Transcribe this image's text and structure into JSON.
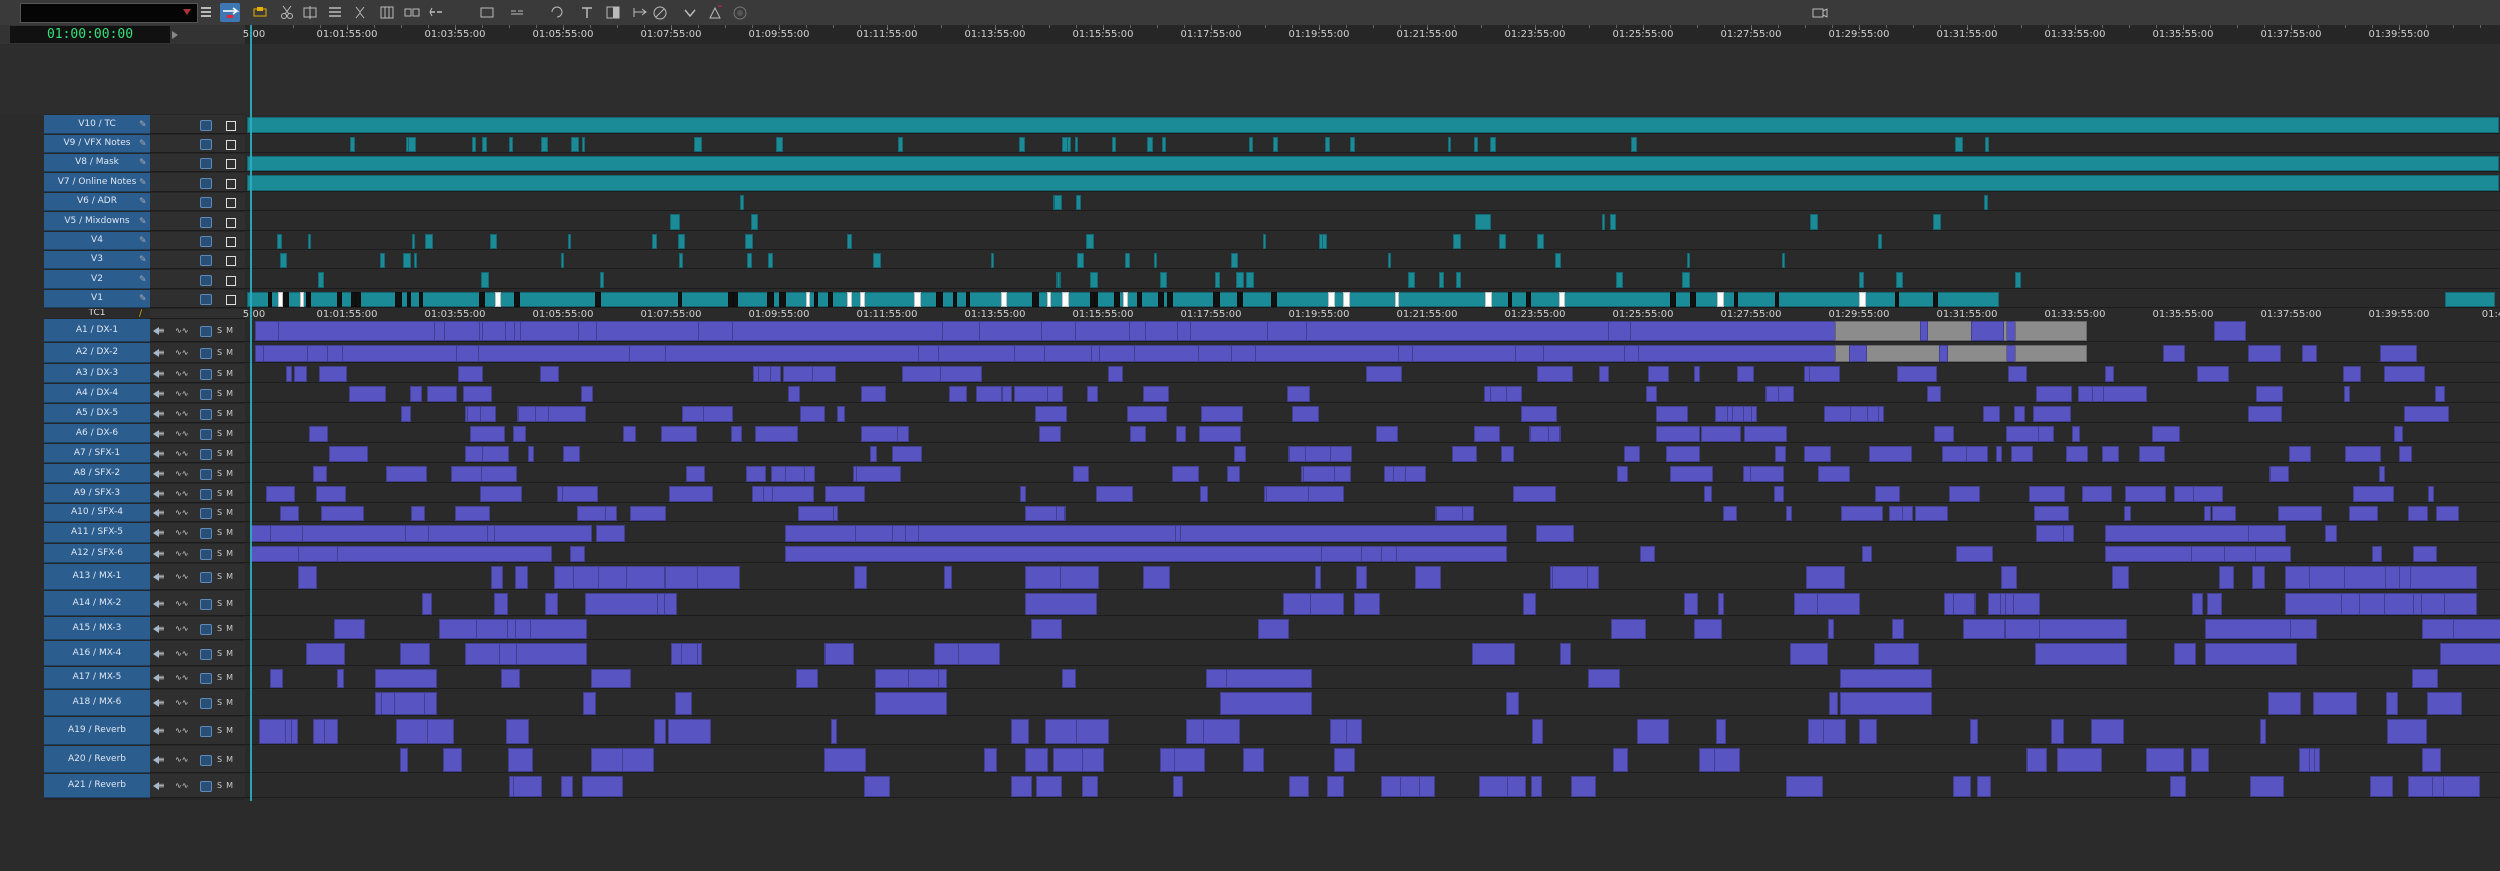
{
  "toolbar": {
    "timecode_label": "",
    "tools": [
      {
        "name": "segment-mode-icon",
        "active": false
      },
      {
        "name": "lift-overwrite-icon",
        "active": true
      },
      {
        "name": "extract-splice-icon",
        "active": false
      },
      {
        "name": "cut-icon",
        "active": false
      },
      {
        "name": "trim-icon",
        "active": false
      },
      {
        "name": "list-icon",
        "active": false
      },
      {
        "name": "split-icon",
        "active": false
      },
      {
        "name": "grid-icon",
        "active": false
      },
      {
        "name": "ripple-icon",
        "active": false
      },
      {
        "name": "snap-icon",
        "active": false
      },
      {
        "name": "add-edit-icon",
        "active": false
      },
      {
        "name": "link-icon",
        "active": false
      },
      {
        "name": "refresh-icon",
        "active": false
      },
      {
        "name": "text-icon",
        "active": false
      },
      {
        "name": "split-view-icon",
        "active": false
      },
      {
        "name": "trim-in-icon",
        "active": false
      },
      {
        "name": "no-icon",
        "active": false
      },
      {
        "name": "checkmark-icon",
        "active": false
      },
      {
        "name": "arrow-tool-icon",
        "active": false
      },
      {
        "name": "record-icon",
        "active": false
      },
      {
        "name": "render-icon",
        "active": false
      }
    ]
  },
  "master_timecode": "01:00:00:00",
  "ruler": {
    "first_label": "5:00",
    "labels": [
      "01:01:55:00",
      "01:03:55:00",
      "01:05:55:00",
      "01:07:55:00",
      "01:09:55:00",
      "01:11:55:00",
      "01:13:55:00",
      "01:15:55:00",
      "01:17:55:00",
      "01:19:55:00",
      "01:21:55:00",
      "01:23:55:00",
      "01:25:55:00",
      "01:27:55:00",
      "01:29:55:00",
      "01:31:55:00",
      "01:33:55:00",
      "01:35:55:00",
      "01:37:55:00",
      "01:39:55:00"
    ],
    "last_label": "01:4"
  },
  "tracks": [
    {
      "name": "V10 / TC",
      "kind": "video"
    },
    {
      "name": "V9 / VFX Notes",
      "kind": "video"
    },
    {
      "name": "V8 / Mask",
      "kind": "video"
    },
    {
      "name": "V7 / Online Notes",
      "kind": "video"
    },
    {
      "name": "V6 / ADR",
      "kind": "video"
    },
    {
      "name": "V5 / Mixdowns",
      "kind": "video"
    },
    {
      "name": "V4",
      "kind": "video"
    },
    {
      "name": "V3",
      "kind": "video"
    },
    {
      "name": "V2",
      "kind": "video"
    },
    {
      "name": "V1",
      "kind": "video"
    },
    {
      "name": "TC1",
      "kind": "timecode"
    },
    {
      "name": "A1 / DX-1",
      "kind": "audio"
    },
    {
      "name": "A2 / DX-2",
      "kind": "audio"
    },
    {
      "name": "A3 / DX-3",
      "kind": "audio"
    },
    {
      "name": "A4 / DX-4",
      "kind": "audio"
    },
    {
      "name": "A5 / DX-5",
      "kind": "audio"
    },
    {
      "name": "A6 / DX-6",
      "kind": "audio"
    },
    {
      "name": "A7 / SFX-1",
      "kind": "audio"
    },
    {
      "name": "A8 / SFX-2",
      "kind": "audio"
    },
    {
      "name": "A9 / SFX-3",
      "kind": "audio"
    },
    {
      "name": "A10 / SFX-4",
      "kind": "audio"
    },
    {
      "name": "A11 / SFX-5",
      "kind": "audio"
    },
    {
      "name": "A12 / SFX-6",
      "kind": "audio"
    },
    {
      "name": "A13 / MX-1",
      "kind": "audio"
    },
    {
      "name": "A14 / MX-2",
      "kind": "audio"
    },
    {
      "name": "A15 / MX-3",
      "kind": "audio"
    },
    {
      "name": "A16 / MX-4",
      "kind": "audio"
    },
    {
      "name": "A17 / MX-5",
      "kind": "audio"
    },
    {
      "name": "A18 / MX-6",
      "kind": "audio"
    },
    {
      "name": "A19 / Reverb",
      "kind": "audio"
    },
    {
      "name": "A20 / Reverb",
      "kind": "audio"
    },
    {
      "name": "A21 / Reverb",
      "kind": "audio"
    }
  ],
  "colors": {
    "video_clip": "#1c8b98",
    "audio_clip": "#5855c2",
    "track_header": "#2c5d8f",
    "timecode_green": "#35e07a",
    "playhead": "#2bb0c0"
  }
}
